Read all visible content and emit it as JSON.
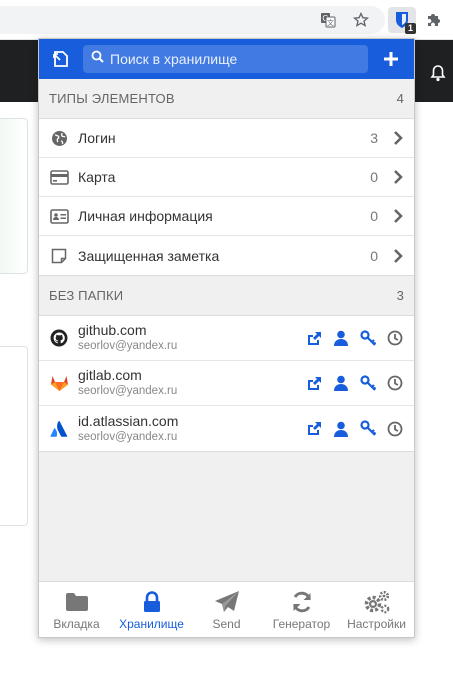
{
  "browser": {
    "extension_badge": "1",
    "icons": [
      "translate-icon",
      "star-icon",
      "bitwarden-extension-icon",
      "puzzle-icon",
      "bell-icon"
    ]
  },
  "popup": {
    "search_placeholder": "Поиск в хранилище",
    "accent_color": "#175ddc",
    "types_section": {
      "title": "ТИПЫ ЭЛЕМЕНТОВ",
      "count": "4",
      "items": [
        {
          "label": "Логин",
          "count": "3",
          "icon": "globe-icon"
        },
        {
          "label": "Карта",
          "count": "0",
          "icon": "credit-card-icon"
        },
        {
          "label": "Личная информация",
          "count": "0",
          "icon": "id-card-icon"
        },
        {
          "label": "Защищенная заметка",
          "count": "0",
          "icon": "sticky-note-icon"
        }
      ]
    },
    "folder_section": {
      "title": "БЕЗ ПАПКИ",
      "count": "3",
      "items": [
        {
          "name": "github.com",
          "user": "seorlov@yandex.ru",
          "icon": "github-icon"
        },
        {
          "name": "gitlab.com",
          "user": "seorlov@yandex.ru",
          "icon": "gitlab-icon"
        },
        {
          "name": "id.atlassian.com",
          "user": "seorlov@yandex.ru",
          "icon": "atlassian-icon"
        }
      ]
    },
    "tabs": [
      {
        "label": "Вкладка",
        "icon": "folder-icon"
      },
      {
        "label": "Хранилище",
        "icon": "lock-icon",
        "active": true
      },
      {
        "label": "Send",
        "icon": "paper-plane-icon"
      },
      {
        "label": "Генератор",
        "icon": "refresh-icon"
      },
      {
        "label": "Настройки",
        "icon": "cogs-icon"
      }
    ]
  }
}
